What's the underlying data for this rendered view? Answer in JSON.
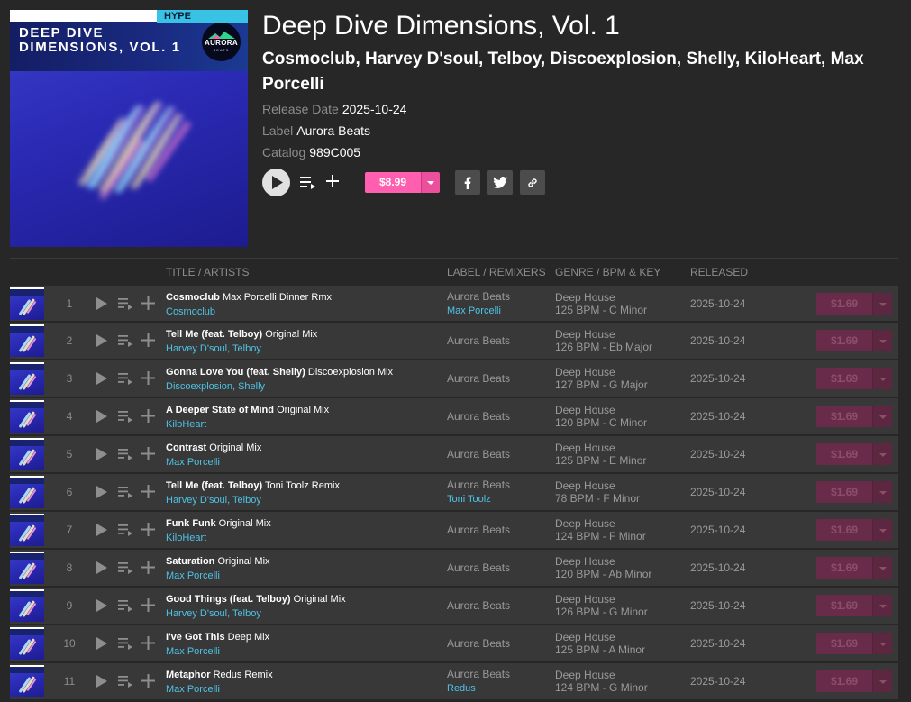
{
  "colors": {
    "background": "#272727",
    "row_background": "#383838",
    "accent_pink": "#ff5fae",
    "link_blue": "#4ec3e6",
    "muted_text": "#8c8c8c"
  },
  "cover": {
    "badge": "HYPE",
    "title_line1": "DEEP DIVE",
    "title_line2": "DIMENSIONS, VOL. 1",
    "logo_text": "AURORA",
    "logo_sub": "BEATS"
  },
  "release": {
    "title": "Deep Dive Dimensions, Vol. 1",
    "artists": "Cosmoclub, Harvey D'soul, Telboy, Discoexplosion, Shelly, KiloHeart, Max Porcelli",
    "release_date_label": "Release Date",
    "release_date": "2025-10-24",
    "label_label": "Label",
    "label": "Aurora Beats",
    "catalog_label": "Catalog",
    "catalog": "989C005",
    "price": "$8.99"
  },
  "actions": {
    "play_icon": "play-icon",
    "queue_icon": "add-to-queue-icon",
    "add_icon": "plus-icon",
    "share_icons": [
      "facebook-icon",
      "twitter-icon",
      "link-icon"
    ]
  },
  "columns": {
    "title_artists": "TITLE / ARTISTS",
    "label_remixers": "LABEL / REMIXERS",
    "genre_bpm_key": "GENRE / BPM & KEY",
    "released": "RELEASED"
  },
  "tracks": [
    {
      "num": "1",
      "title": "Cosmoclub",
      "mix": "Max Porcelli Dinner Rmx",
      "artists": "Cosmoclub",
      "label": "Aurora Beats",
      "remixer": "Max Porcelli",
      "genre": "Deep House",
      "bpm_key": "125 BPM - C Minor",
      "released": "2025-10-24",
      "price": "$1.69"
    },
    {
      "num": "2",
      "title": "Tell Me (feat. Telboy)",
      "mix": "Original Mix",
      "artists": "Harvey D'soul, Telboy",
      "label": "Aurora Beats",
      "remixer": "",
      "genre": "Deep House",
      "bpm_key": "126 BPM - Eb Major",
      "released": "2025-10-24",
      "price": "$1.69"
    },
    {
      "num": "3",
      "title": "Gonna Love You (feat. Shelly)",
      "mix": "Discoexplosion Mix",
      "artists": "Discoexplosion, Shelly",
      "label": "Aurora Beats",
      "remixer": "",
      "genre": "Deep House",
      "bpm_key": "127 BPM - G Major",
      "released": "2025-10-24",
      "price": "$1.69"
    },
    {
      "num": "4",
      "title": "A Deeper State of Mind",
      "mix": "Original Mix",
      "artists": "KiloHeart",
      "label": "Aurora Beats",
      "remixer": "",
      "genre": "Deep House",
      "bpm_key": "120 BPM - C Minor",
      "released": "2025-10-24",
      "price": "$1.69"
    },
    {
      "num": "5",
      "title": "Contrast",
      "mix": "Original Mix",
      "artists": "Max Porcelli",
      "label": "Aurora Beats",
      "remixer": "",
      "genre": "Deep House",
      "bpm_key": "125 BPM - E Minor",
      "released": "2025-10-24",
      "price": "$1.69"
    },
    {
      "num": "6",
      "title": "Tell Me (feat. Telboy)",
      "mix": "Toni Toolz Remix",
      "artists": "Harvey D'soul, Telboy",
      "label": "Aurora Beats",
      "remixer": "Toni Toolz",
      "genre": "Deep House",
      "bpm_key": "78 BPM - F Minor",
      "released": "2025-10-24",
      "price": "$1.69"
    },
    {
      "num": "7",
      "title": "Funk Funk",
      "mix": "Original Mix",
      "artists": "KiloHeart",
      "label": "Aurora Beats",
      "remixer": "",
      "genre": "Deep House",
      "bpm_key": "124 BPM - F Minor",
      "released": "2025-10-24",
      "price": "$1.69"
    },
    {
      "num": "8",
      "title": "Saturation",
      "mix": "Original Mix",
      "artists": "Max Porcelli",
      "label": "Aurora Beats",
      "remixer": "",
      "genre": "Deep House",
      "bpm_key": "120 BPM - Ab Minor",
      "released": "2025-10-24",
      "price": "$1.69"
    },
    {
      "num": "9",
      "title": "Good Things (feat. Telboy)",
      "mix": "Original Mix",
      "artists": "Harvey D'soul, Telboy",
      "label": "Aurora Beats",
      "remixer": "",
      "genre": "Deep House",
      "bpm_key": "126 BPM - G Minor",
      "released": "2025-10-24",
      "price": "$1.69"
    },
    {
      "num": "10",
      "title": "I've Got This",
      "mix": "Deep Mix",
      "artists": "Max Porcelli",
      "label": "Aurora Beats",
      "remixer": "",
      "genre": "Deep House",
      "bpm_key": "125 BPM - A Minor",
      "released": "2025-10-24",
      "price": "$1.69"
    },
    {
      "num": "11",
      "title": "Metaphor",
      "mix": "Redus Remix",
      "artists": "Max Porcelli",
      "label": "Aurora Beats",
      "remixer": "Redus",
      "genre": "Deep House",
      "bpm_key": "124 BPM - G Minor",
      "released": "2025-10-24",
      "price": "$1.69"
    }
  ]
}
